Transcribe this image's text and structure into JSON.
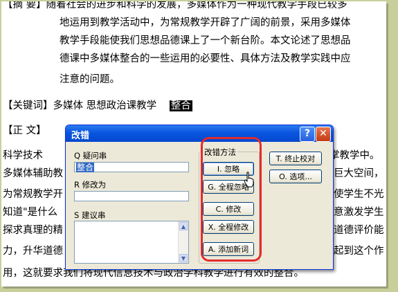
{
  "document": {
    "lines": [
      "【摘  要】随着社会的进步和科学的发展，多媒体作为一种现代教学手段已较多",
      "地运用到教学活动中，为常规教学开辟了广阔的前景，采用多媒体",
      "教学手段能使我们思想品德课上了一个新台阶。本文论述了思想品",
      "德课中多媒体整合的一些运用的必要性、具体方法及教学实践中应",
      "注意的问题。",
      "【关键词】多媒体  思想政治课教学",
      "整合",
      "【正  文】",
      "    科学技术",
      "掌教学中。",
      "多媒体辅助教",
      "巨大空间，",
      "为常规教学开",
      "使学生不光",
      "知道\"是什么",
      "意激发学生",
      "探求真理的精",
      "道德评价能",
      "力，升华道德",
      "起到这个作",
      "用，这就要求我们将现代信息技术与政治学科教学进行有效的整合。"
    ]
  },
  "dialog": {
    "title": "改错",
    "help_label": "?",
    "close_label": "✕",
    "query_label": "Q 疑问串",
    "query_value": "整合",
    "correct_label": "R 修改为",
    "correct_value": "",
    "suggest_label": "S 建议串",
    "method_group": "改错方法",
    "buttons": {
      "ignore": "I. 忽略",
      "ignore_all": "G. 全程忽略",
      "modify": "C. 修改",
      "modify_all": "X. 全程修改",
      "add_word": "A. 添加新词",
      "stop": "T. 终止校对",
      "options": "O. 选项..."
    }
  },
  "colors": {
    "annotation": "#e52a2a",
    "titlebar": "#0a56e0",
    "selection": "#316ac5"
  }
}
